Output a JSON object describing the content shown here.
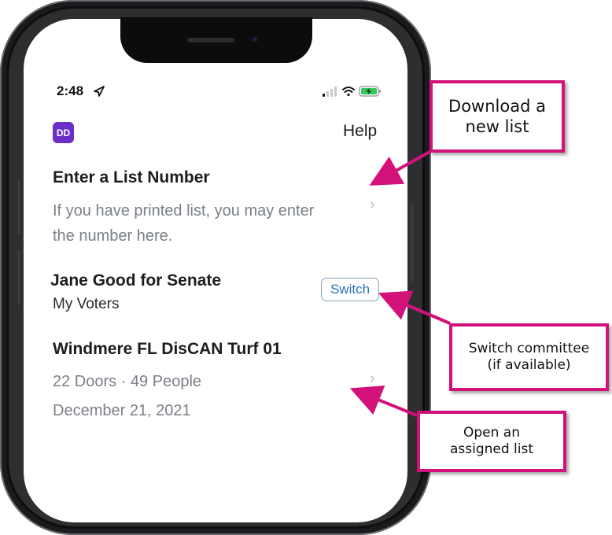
{
  "status_bar": {
    "time": "2:48"
  },
  "header": {
    "avatar_initials": "DD",
    "help_label": "Help"
  },
  "enter_list": {
    "title": "Enter a List Number",
    "description": "If you have printed list, you may enter\nthe number here."
  },
  "committee": {
    "name": "Jane Good for Senate",
    "subtitle": "My Voters",
    "switch_label": "Switch"
  },
  "assigned_list": {
    "title": "Windmere FL DisCAN Turf 01",
    "counts": "22 Doors · 49 People",
    "date": "December 21, 2021"
  },
  "callouts": {
    "download": "Download a\nnew list",
    "switch": "Switch committee\n(if available)",
    "open": "Open an\nassigned list"
  },
  "colors": {
    "accent": "#d2117a",
    "avatar": "#6b2fc7",
    "link": "#2f6fb8"
  }
}
